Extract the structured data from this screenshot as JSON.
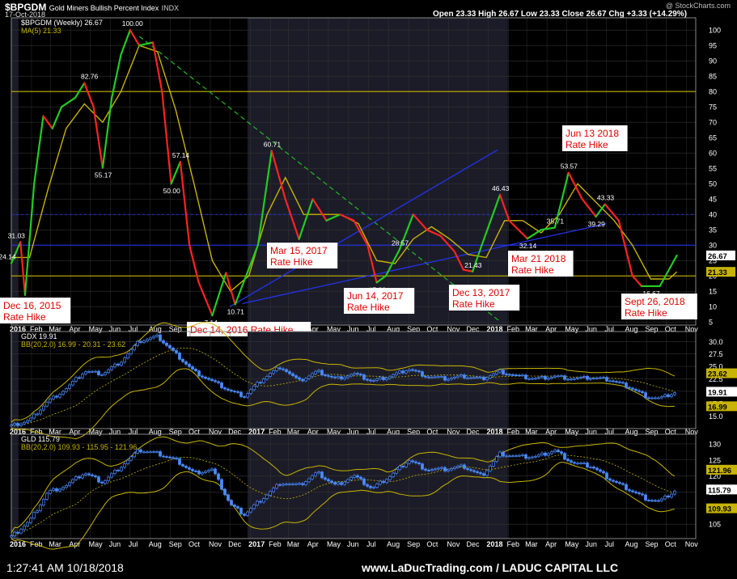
{
  "header": {
    "symbol": "$BPGDM",
    "full_name": "Gold Miners Bullish Percent Index",
    "exchange": "INDX",
    "date": "17-Oct-2018",
    "ohlc": "Open 23.33  High 26.67  Low 23.33  Close 26.67  Chg +3.33 (+14.29%)",
    "brand": "@ StockCharts.com"
  },
  "colors": {
    "up": "#22cc22",
    "down": "#ff2222",
    "ma": "#c8b400",
    "trend_blue": "#2233ee",
    "downtrend": "#22bb22",
    "candles": "#4a8cff",
    "shade": "#1c1c28",
    "grid": "#333333"
  },
  "x_axis": {
    "labels": [
      "2016",
      "Feb",
      "Mar",
      "Apr",
      "May",
      "Jun",
      "Jul",
      "Aug",
      "Sep",
      "Oct",
      "Nov",
      "Dec",
      "2017",
      "Feb",
      "Mar",
      "Apr",
      "May",
      "Jun",
      "Jul",
      "Aug",
      "Sep",
      "Oct",
      "Nov",
      "Dec",
      "2018",
      "Feb",
      "Mar",
      "Apr",
      "May",
      "Jun",
      "Jul",
      "Aug",
      "Sep",
      "Oct",
      "Nov"
    ]
  },
  "chart_data": [
    {
      "type": "line",
      "panel": "main",
      "title": "$BPGDM (Weekly) 26.67",
      "ma_label": "MA(5) 21.33",
      "ylim": [
        4,
        104
      ],
      "yticks": [
        5,
        10,
        15,
        20,
        25,
        30,
        35,
        40,
        45,
        50,
        55,
        60,
        65,
        70,
        75,
        80,
        85,
        90,
        95,
        100
      ],
      "last_labels": [
        "26.67",
        "21.33"
      ],
      "series": [
        {
          "name": "$BPGDM (Weekly)",
          "points": [
            [
              "2016-01-01",
              24.14
            ],
            [
              "2016-01-15",
              31.03
            ],
            [
              "2016-01-22",
              13.79
            ],
            [
              "2016-02-05",
              50
            ],
            [
              "2016-02-19",
              72
            ],
            [
              "2016-03-04",
              68
            ],
            [
              "2016-03-18",
              75
            ],
            [
              "2016-04-08",
              78
            ],
            [
              "2016-04-22",
              82.76
            ],
            [
              "2016-05-06",
              75
            ],
            [
              "2016-05-20",
              55.17
            ],
            [
              "2016-06-03",
              78
            ],
            [
              "2016-06-17",
              92
            ],
            [
              "2016-07-01",
              100
            ],
            [
              "2016-07-15",
              95
            ],
            [
              "2016-08-05",
              96
            ],
            [
              "2016-08-19",
              80
            ],
            [
              "2016-09-02",
              50
            ],
            [
              "2016-09-16",
              57.14
            ],
            [
              "2016-09-30",
              30
            ],
            [
              "2016-10-14",
              18
            ],
            [
              "2016-11-04",
              7.14
            ],
            [
              "2016-11-25",
              21
            ],
            [
              "2016-12-09",
              10.71
            ],
            [
              "2017-01-13",
              30
            ],
            [
              "2017-02-03",
              60.71
            ],
            [
              "2017-02-24",
              45
            ],
            [
              "2017-03-17",
              32
            ],
            [
              "2017-04-07",
              45
            ],
            [
              "2017-04-28",
              38
            ],
            [
              "2017-05-19",
              40
            ],
            [
              "2017-06-09",
              38
            ],
            [
              "2017-06-30",
              30
            ],
            [
              "2017-07-14",
              17.86
            ],
            [
              "2017-07-28",
              20
            ],
            [
              "2017-08-18",
              28.57
            ],
            [
              "2017-09-08",
              40
            ],
            [
              "2017-09-29",
              35
            ],
            [
              "2017-10-20",
              33
            ],
            [
              "2017-11-10",
              28
            ],
            [
              "2017-11-24",
              22
            ],
            [
              "2017-12-08",
              21.43
            ],
            [
              "2017-12-22",
              30
            ],
            [
              "2018-01-19",
              46.43
            ],
            [
              "2018-02-02",
              38
            ],
            [
              "2018-03-02",
              32.14
            ],
            [
              "2018-03-23",
              35
            ],
            [
              "2018-04-13",
              35.71
            ],
            [
              "2018-05-04",
              53.57
            ],
            [
              "2018-05-25",
              45
            ],
            [
              "2018-06-15",
              39.29
            ],
            [
              "2018-06-29",
              43.33
            ],
            [
              "2018-07-20",
              38
            ],
            [
              "2018-08-10",
              20
            ],
            [
              "2018-08-24",
              16.67
            ],
            [
              "2018-09-21",
              16.67
            ],
            [
              "2018-10-17",
              26.67
            ]
          ]
        },
        {
          "name": "MA(5)",
          "points": [
            [
              "2016-01-01",
              26
            ],
            [
              "2016-01-29",
              26
            ],
            [
              "2016-02-26",
              48
            ],
            [
              "2016-03-25",
              68
            ],
            [
              "2016-04-22",
              76
            ],
            [
              "2016-05-20",
              70
            ],
            [
              "2016-06-17",
              80
            ],
            [
              "2016-07-15",
              95
            ],
            [
              "2016-08-12",
              93
            ],
            [
              "2016-09-09",
              74
            ],
            [
              "2016-10-07",
              50
            ],
            [
              "2016-11-04",
              25
            ],
            [
              "2016-12-02",
              15
            ],
            [
              "2016-12-30",
              20
            ],
            [
              "2017-01-27",
              40
            ],
            [
              "2017-02-24",
              52
            ],
            [
              "2017-03-24",
              40
            ],
            [
              "2017-04-21",
              40
            ],
            [
              "2017-05-19",
              40
            ],
            [
              "2017-06-16",
              37
            ],
            [
              "2017-07-14",
              25
            ],
            [
              "2017-08-11",
              24
            ],
            [
              "2017-09-08",
              32
            ],
            [
              "2017-10-06",
              36
            ],
            [
              "2017-11-03",
              32
            ],
            [
              "2017-12-01",
              27
            ],
            [
              "2017-12-29",
              26
            ],
            [
              "2018-01-26",
              38
            ],
            [
              "2018-02-23",
              38
            ],
            [
              "2018-03-23",
              34
            ],
            [
              "2018-04-20",
              40
            ],
            [
              "2018-05-18",
              50
            ],
            [
              "2018-06-15",
              44
            ],
            [
              "2018-07-13",
              38
            ],
            [
              "2018-08-10",
              30
            ],
            [
              "2018-09-07",
              19
            ],
            [
              "2018-10-05",
              19
            ],
            [
              "2018-10-17",
              21.33
            ]
          ]
        }
      ],
      "point_labels": [
        [
          "2016-01-08",
          31.03,
          "31.03"
        ],
        [
          "2015-12-25",
          24.14,
          "24.14"
        ],
        [
          "2016-01-22",
          13.79,
          "13.79"
        ],
        [
          "2016-04-29",
          82.76,
          "82.76"
        ],
        [
          "2016-05-20",
          55.17,
          "55.17"
        ],
        [
          "2016-07-01",
          100,
          "100.00"
        ],
        [
          "2016-09-02",
          50,
          "50.00"
        ],
        [
          "2016-09-16",
          57.14,
          "57.14"
        ],
        [
          "2016-11-04",
          7.14,
          "7.14"
        ],
        [
          "2016-12-09",
          10.71,
          "10.71"
        ],
        [
          "2017-02-03",
          60.71,
          "60.71"
        ],
        [
          "2017-07-14",
          17.86,
          "17.86"
        ],
        [
          "2017-08-18",
          28.57,
          "28.57"
        ],
        [
          "2017-12-08",
          21.43,
          "21.43"
        ],
        [
          "2018-01-19",
          46.43,
          "46.43"
        ],
        [
          "2018-03-02",
          32.14,
          "32.14"
        ],
        [
          "2018-04-13",
          35.71,
          "35.71"
        ],
        [
          "2018-05-04",
          53.57,
          "53.57"
        ],
        [
          "2018-06-15",
          39.29,
          "39.29"
        ],
        [
          "2018-06-29",
          43.33,
          "43.33"
        ],
        [
          "2018-09-07",
          16.67,
          "16.67"
        ]
      ],
      "annotations": [
        "Dec 16, 2015\nRate Hike",
        "Dec 14, 2016 Rate Hike",
        "Mar 15, 2017\nRate Hike",
        "Jun 14, 2017\nRate Hike",
        "Dec 13, 2017\nRate Hike",
        "Mar 21 2018\nRate Hike",
        "Jun 13 2018\nRate Hike",
        "Sept 26, 2018\nRate Hike"
      ]
    },
    {
      "type": "candlestick",
      "panel": "gdx",
      "title": "GDX 19.91",
      "bb_label": "BB(20,2.0) 16.99 - 20.31 - 23.62",
      "ylim": [
        12.5,
        32
      ],
      "yticks": [
        15,
        17.5,
        20,
        22.5,
        25,
        27.5,
        30
      ],
      "ytick_labels": [
        "15.0",
        "17.5",
        "20.0",
        "22.5",
        "25.0",
        "27.5",
        "30.0"
      ],
      "last_labels": [
        "23.62",
        "19.91",
        "16.99"
      ],
      "closes": [
        [
          "2016-01-01",
          13
        ],
        [
          "2016-01-29",
          14.2
        ],
        [
          "2016-02-26",
          18
        ],
        [
          "2016-03-25",
          20.5
        ],
        [
          "2016-04-22",
          24
        ],
        [
          "2016-05-20",
          23.5
        ],
        [
          "2016-06-17",
          26
        ],
        [
          "2016-07-15",
          30
        ],
        [
          "2016-08-12",
          31
        ],
        [
          "2016-09-09",
          27.5
        ],
        [
          "2016-10-07",
          24
        ],
        [
          "2016-11-04",
          22
        ],
        [
          "2016-12-02",
          20
        ],
        [
          "2016-12-23",
          19
        ],
        [
          "2017-01-20",
          22.5
        ],
        [
          "2017-02-17",
          25
        ],
        [
          "2017-03-17",
          22
        ],
        [
          "2017-04-14",
          24
        ],
        [
          "2017-05-12",
          22.5
        ],
        [
          "2017-06-09",
          23.5
        ],
        [
          "2017-07-07",
          22
        ],
        [
          "2017-08-04",
          23
        ],
        [
          "2017-09-01",
          24.5
        ],
        [
          "2017-09-29",
          23
        ],
        [
          "2017-10-27",
          22.5
        ],
        [
          "2017-11-24",
          23
        ],
        [
          "2017-12-22",
          22.5
        ],
        [
          "2018-01-19",
          24
        ],
        [
          "2018-02-16",
          23
        ],
        [
          "2018-03-16",
          22.5
        ],
        [
          "2018-04-13",
          23
        ],
        [
          "2018-05-11",
          22.5
        ],
        [
          "2018-06-08",
          22.7
        ],
        [
          "2018-07-06",
          22.3
        ],
        [
          "2018-08-03",
          21
        ],
        [
          "2018-08-31",
          19
        ],
        [
          "2018-09-21",
          18.5
        ],
        [
          "2018-10-17",
          19.91
        ]
      ]
    },
    {
      "type": "candlestick",
      "panel": "gld",
      "title": "GLD 115.79",
      "bb_label": "BB(20,2.0) 109.93 - 115.95 - 121.96",
      "ylim": [
        100.5,
        133
      ],
      "yticks": [
        105,
        110,
        115,
        120,
        125,
        130
      ],
      "last_labels": [
        "121.96",
        "115.79",
        "109.93"
      ],
      "closes": [
        [
          "2016-01-01",
          101
        ],
        [
          "2016-01-29",
          106
        ],
        [
          "2016-02-26",
          115
        ],
        [
          "2016-03-25",
          117
        ],
        [
          "2016-04-22",
          121
        ],
        [
          "2016-05-20",
          118
        ],
        [
          "2016-06-17",
          123
        ],
        [
          "2016-07-15",
          128
        ],
        [
          "2016-08-12",
          127
        ],
        [
          "2016-09-09",
          125
        ],
        [
          "2016-10-07",
          121
        ],
        [
          "2016-11-04",
          122
        ],
        [
          "2016-12-02",
          111
        ],
        [
          "2016-12-23",
          108
        ],
        [
          "2017-01-20",
          113
        ],
        [
          "2017-02-17",
          118
        ],
        [
          "2017-03-17",
          117
        ],
        [
          "2017-04-14",
          121
        ],
        [
          "2017-05-12",
          117
        ],
        [
          "2017-06-09",
          120
        ],
        [
          "2017-07-07",
          116
        ],
        [
          "2017-08-04",
          120
        ],
        [
          "2017-09-01",
          125
        ],
        [
          "2017-09-29",
          122
        ],
        [
          "2017-10-27",
          122
        ],
        [
          "2017-11-24",
          123
        ],
        [
          "2017-12-22",
          120
        ],
        [
          "2018-01-19",
          127
        ],
        [
          "2018-02-16",
          126
        ],
        [
          "2018-03-16",
          126
        ],
        [
          "2018-04-13",
          128
        ],
        [
          "2018-05-11",
          124
        ],
        [
          "2018-06-08",
          123
        ],
        [
          "2018-07-06",
          119
        ],
        [
          "2018-08-03",
          116
        ],
        [
          "2018-08-31",
          113
        ],
        [
          "2018-09-21",
          112
        ],
        [
          "2018-10-17",
          115.79
        ]
      ]
    }
  ],
  "footer": {
    "time": "1:27:41 AM 10/18/2018",
    "site": "www.LaDucTrading.com / LADUC CAPITAL LLC"
  }
}
